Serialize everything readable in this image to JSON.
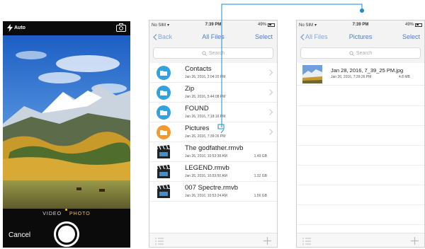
{
  "camera": {
    "flash_label": "Auto",
    "modes": [
      "VIDEO",
      "PHOTO"
    ],
    "active_mode": "PHOTO",
    "cancel_label": "Cancel"
  },
  "file_browser": {
    "status": {
      "carrier": "No SIM",
      "time": "7:39 PM",
      "battery": "49%"
    },
    "back_label": "Back",
    "title": "All Files",
    "select_label": "Select",
    "search_placeholder": "Search",
    "items": [
      {
        "name": "Contacts",
        "date": "Jan 26, 2016, 2:04:20 PM",
        "size": "",
        "kind": "folder",
        "icon": "folder-icon",
        "color": "#2fa2df"
      },
      {
        "name": "Zip",
        "date": "Jan 26, 2016, 5:44:08 PM",
        "size": "",
        "kind": "folder",
        "icon": "folder-icon",
        "color": "#2fa2df"
      },
      {
        "name": "FOUND",
        "date": "Jan 26, 2016, 7:18:16 PM",
        "size": "",
        "kind": "folder",
        "icon": "folder-icon",
        "color": "#2fa2df"
      },
      {
        "name": "Pictures",
        "date": "Jan 26, 2016, 7:39:26 PM",
        "size": "",
        "kind": "folder",
        "icon": "pictures-folder-icon",
        "color": "#f29a2e"
      },
      {
        "name": "The godfather.rmvb",
        "date": "Jan 26, 2016, 10:53:38 AM",
        "size": "1.49 GB",
        "kind": "video",
        "icon": "clapperboard-icon"
      },
      {
        "name": "LEGEND.rmvb",
        "date": "Jan 26, 2016, 10:53:50 AM",
        "size": "1.32 GB",
        "kind": "video",
        "icon": "clapperboard-icon"
      },
      {
        "name": "007 Spectre.rmvb",
        "date": "Jan 26, 2016, 10:53:24 AM",
        "size": "1.56 GB",
        "kind": "video",
        "icon": "clapperboard-icon"
      }
    ]
  },
  "pictures_view": {
    "status": {
      "carrier": "No SIM",
      "time": "7:39 PM",
      "battery": "49%"
    },
    "back_label": "All Files",
    "title": "Pictures",
    "select_label": "Select",
    "search_placeholder": "Search",
    "items": [
      {
        "name": "Jan 28, 2016, 7_39_25 PM.jpg",
        "date": "Jan 26, 2016, 7:39:26 PM",
        "size": "4.8 MB"
      }
    ]
  },
  "colors": {
    "accent": "#4a7fc0",
    "folder_blue": "#2fa2df",
    "folder_orange": "#f29a2e",
    "connector": "#1e88d0",
    "camera_mode_active": "#f5c518"
  }
}
